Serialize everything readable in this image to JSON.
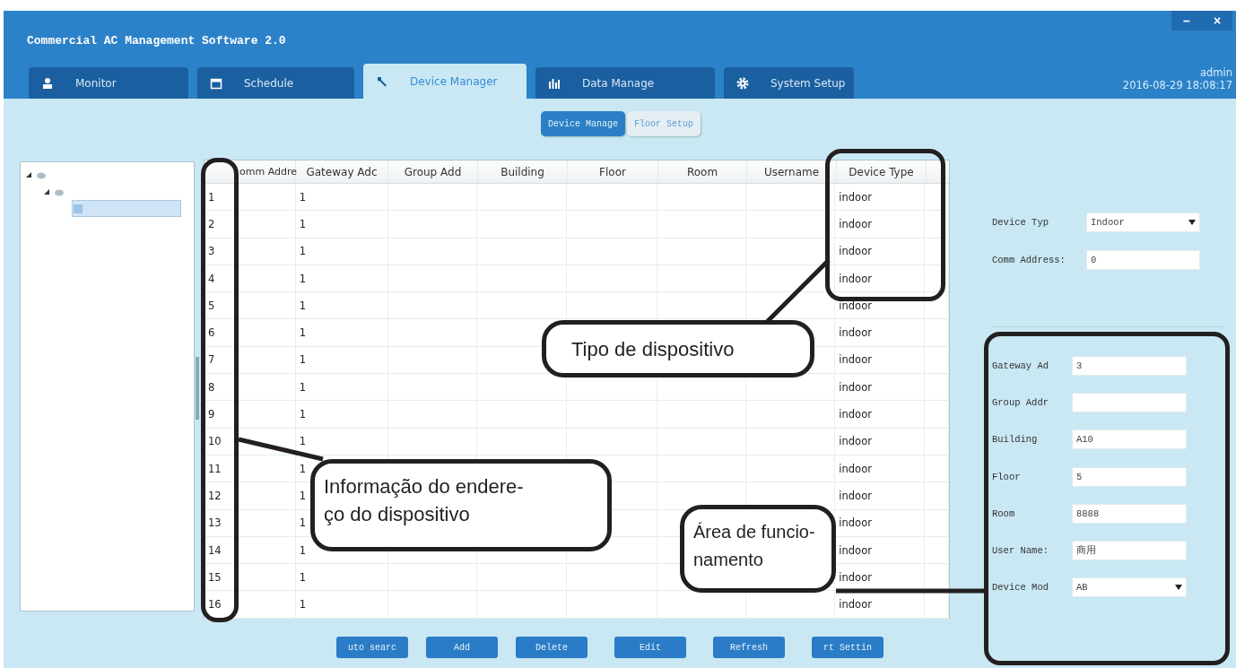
{
  "window": {
    "title": "Commercial AC Management Software 2.0",
    "controls": [
      "–",
      "×"
    ]
  },
  "tabs": [
    {
      "label": "Monitor",
      "selected": false
    },
    {
      "label": "Schedule",
      "selected": false
    },
    {
      "label": "Device Manager",
      "selected": true
    },
    {
      "label": "Data Manage",
      "selected": false
    },
    {
      "label": "System Setup",
      "selected": false
    }
  ],
  "user": {
    "name": "admin",
    "datetime": "2016-08-29 18:08:17"
  },
  "subtabs": [
    {
      "label": "Device Manage",
      "selected": true
    },
    {
      "label": "Floor Setup",
      "selected": false
    }
  ],
  "tree": [
    {
      "expanded": true,
      "selected": false,
      "children": [
        {
          "expanded": true,
          "selected": false,
          "children": [
            {
              "selected": true
            }
          ]
        }
      ]
    }
  ],
  "table": {
    "columns": [
      "omm Addre",
      "Gateway Adc",
      "Group Add",
      "Building",
      "Floor",
      "Room",
      "Username",
      "Device Type"
    ],
    "rows": [
      [
        "1",
        "1",
        "",
        "",
        "",
        "",
        "",
        "indoor"
      ],
      [
        "2",
        "1",
        "",
        "",
        "",
        "",
        "",
        "indoor"
      ],
      [
        "3",
        "1",
        "",
        "",
        "",
        "",
        "",
        "indoor"
      ],
      [
        "4",
        "1",
        "",
        "",
        "",
        "",
        "",
        "indoor"
      ],
      [
        "5",
        "1",
        "",
        "",
        "",
        "",
        "",
        "indoor"
      ],
      [
        "6",
        "1",
        "",
        "",
        "",
        "",
        "",
        "indoor"
      ],
      [
        "7",
        "1",
        "",
        "",
        "",
        "",
        "",
        "indoor"
      ],
      [
        "8",
        "1",
        "",
        "",
        "",
        "",
        "",
        "indoor"
      ],
      [
        "9",
        "1",
        "",
        "",
        "",
        "",
        "",
        "indoor"
      ],
      [
        "10",
        "1",
        "",
        "",
        "",
        "",
        "",
        "indoor"
      ],
      [
        "11",
        "1",
        "",
        "",
        "",
        "",
        "",
        "indoor"
      ],
      [
        "12",
        "1",
        "",
        "",
        "",
        "",
        "",
        "indoor"
      ],
      [
        "13",
        "1",
        "",
        "",
        "",
        "",
        "",
        "indoor"
      ],
      [
        "14",
        "1",
        "",
        "",
        "",
        "",
        "",
        "indoor"
      ],
      [
        "15",
        "1",
        "",
        "",
        "",
        "",
        "",
        "indoor"
      ],
      [
        "16",
        "1",
        "",
        "",
        "",
        "",
        "",
        "indoor"
      ]
    ]
  },
  "form_top": [
    {
      "label": "Device Typ",
      "value": "Indoor",
      "kind": "select"
    },
    {
      "label": "Comm Address:",
      "value": "0",
      "kind": "text"
    }
  ],
  "form_bottom": [
    {
      "label": "Gateway Ad",
      "value": "3",
      "kind": "text"
    },
    {
      "label": "Group Addr",
      "kind": "text"
    },
    {
      "label": "Building",
      "value": "A10",
      "kind": "text"
    },
    {
      "label": "Floor",
      "value": "5",
      "kind": "text"
    },
    {
      "label": "Room",
      "value": "8888",
      "kind": "text"
    },
    {
      "label": "User Name:",
      "value": "商用",
      "kind": "text"
    },
    {
      "label": "Device Mod",
      "value": "AB",
      "kind": "select"
    }
  ],
  "buttons": [
    "uto searc",
    "Add",
    "Delete",
    "Edit",
    "Refresh",
    "rt Settin"
  ],
  "callouts": [
    {
      "lines": [
        "Informação do endere-",
        "ço do dispositivo"
      ]
    },
    {
      "lines": [
        "Tipo de dispositivo"
      ]
    },
    {
      "lines": [
        "Área de funcio-",
        "namento"
      ]
    }
  ]
}
